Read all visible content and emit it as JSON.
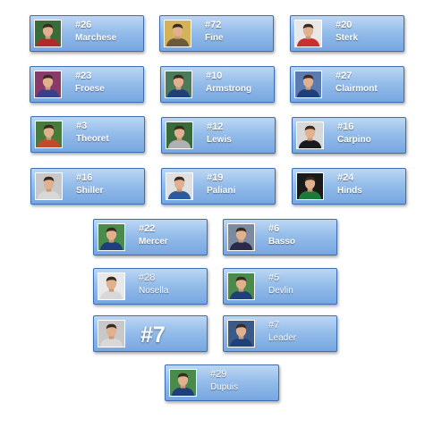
{
  "players": [
    {
      "number": "#26",
      "name": "Marchese",
      "jersey_color": "#b22a2a",
      "bg_color": "#3a6b3a",
      "icon": "player-portrait-icon"
    },
    {
      "number": "#72",
      "name": "Fine",
      "jersey_color": "#6b5a3a",
      "bg_color": "#d4b25a",
      "icon": "player-portrait-icon"
    },
    {
      "number": "#20",
      "name": "Sterk",
      "jersey_color": "#c8302e",
      "bg_color": "#e8e8e8",
      "icon": "player-portrait-icon"
    },
    {
      "number": "#23",
      "name": "Froese",
      "jersey_color": "#3a3f8a",
      "bg_color": "#8a3a6a",
      "icon": "player-portrait-icon"
    },
    {
      "number": "#10",
      "name": "Armstrong",
      "jersey_color": "#1f3f7a",
      "bg_color": "#4a7a5a",
      "icon": "player-portrait-icon"
    },
    {
      "number": "#27",
      "name": "Clairmont",
      "jersey_color": "#1f3f7a",
      "bg_color": "#5a7ab0",
      "icon": "player-portrait-icon"
    },
    {
      "number": "#3",
      "name": "Theoret",
      "jersey_color": "#c04a2a",
      "bg_color": "#4a7a3a",
      "icon": "player-portrait-icon"
    },
    {
      "number": "#12",
      "name": "Lewis",
      "jersey_color": "#b0b0b0",
      "bg_color": "#3a6a3a",
      "icon": "player-portrait-icon"
    },
    {
      "number": "#16",
      "name": "Carpino",
      "jersey_color": "#1a1a1a",
      "bg_color": "#d8d8d8",
      "icon": "player-portrait-icon"
    },
    {
      "number": "#16",
      "name": "Shiller",
      "jersey_color": "#d8d8d8",
      "bg_color": "#c8c8c8",
      "icon": "player-portrait-icon"
    },
    {
      "number": "#19",
      "name": "Paliani",
      "jersey_color": "#2a5aa0",
      "bg_color": "#e0e0e0",
      "icon": "player-portrait-icon"
    },
    {
      "number": "#24",
      "name": "Hinds",
      "jersey_color": "#1a7a3a",
      "bg_color": "#1a1a1a",
      "icon": "player-portrait-icon"
    },
    {
      "number": "#22",
      "name": "Mercer",
      "jersey_color": "#1f3f7a",
      "bg_color": "#4a8a4a",
      "icon": "player-portrait-icon"
    },
    {
      "number": "#6",
      "name": "Basso",
      "jersey_color": "#2a2a4a",
      "bg_color": "#7a8aa0",
      "icon": "player-portrait-icon"
    },
    {
      "number": "#28",
      "name": "Nosella",
      "jersey_color": "#d8d8d8",
      "bg_color": "#e8e8e8",
      "icon": "player-portrait-icon"
    },
    {
      "number": "#5",
      "name": "Devlin",
      "jersey_color": "#1f3f7a",
      "bg_color": "#4a8a4a",
      "icon": "player-portrait-icon"
    },
    {
      "number": "#7",
      "name": "",
      "jersey_color": "#d8d8d8",
      "bg_color": "#c8c8c8",
      "icon": "player-portrait-icon"
    },
    {
      "number": "#7",
      "name": "Leader",
      "jersey_color": "#1f3f7a",
      "bg_color": "#3a5a8a",
      "icon": "player-portrait-icon"
    },
    {
      "number": "#29",
      "name": "Dupuis",
      "jersey_color": "#1f3f7a",
      "bg_color": "#4a8a4a",
      "icon": "player-portrait-icon"
    }
  ]
}
